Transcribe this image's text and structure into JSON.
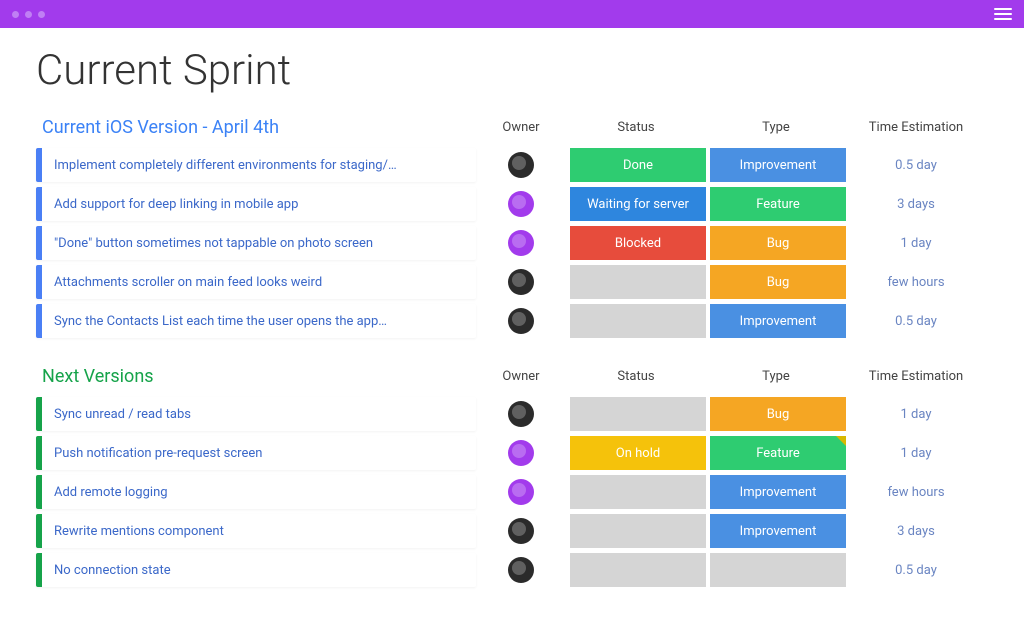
{
  "page_title": "Current Sprint",
  "columns": {
    "owner": "Owner",
    "status": "Status",
    "type": "Type",
    "time": "Time Estimation"
  },
  "status_colors": {
    "Done": "chip-done",
    "Waiting for server": "chip-waiting",
    "Blocked": "chip-blocked",
    "On hold": "chip-onhold",
    "": "chip-none"
  },
  "type_colors": {
    "Improvement": "chip-improvement",
    "Feature": "chip-feature",
    "Bug": "chip-bug"
  },
  "groups": [
    {
      "title": "Current iOS Version - April 4th",
      "stripe": "blue",
      "title_color": "blue",
      "rows": [
        {
          "task": "Implement completely different environments for staging/…",
          "owner": "dark",
          "status": "Done",
          "type": "Improvement",
          "time": "0.5 day"
        },
        {
          "task": "Add support for deep linking in mobile app",
          "owner": "purple",
          "status": "Waiting for server",
          "type": "Feature",
          "time": "3 days"
        },
        {
          "task": "\"Done\" button sometimes not tappable on photo screen",
          "owner": "purple",
          "status": "Blocked",
          "type": "Bug",
          "time": "1 day"
        },
        {
          "task": "Attachments scroller on main feed looks weird",
          "owner": "dark",
          "status": "",
          "type": "Bug",
          "time": "few hours"
        },
        {
          "task": "Sync the Contacts List each time the user opens the app…",
          "owner": "dark",
          "status": "",
          "type": "Improvement",
          "time": "0.5 day"
        }
      ]
    },
    {
      "title": "Next Versions",
      "stripe": "green",
      "title_color": "green",
      "rows": [
        {
          "task": "Sync unread / read tabs",
          "owner": "dark",
          "status": "",
          "type": "Bug",
          "time": "1 day"
        },
        {
          "task": "Push notification pre-request screen",
          "owner": "purple",
          "status": "On hold",
          "type": "Feature",
          "time": "1 day",
          "corner": true
        },
        {
          "task": "Add remote logging",
          "owner": "purple",
          "status": "",
          "type": "Improvement",
          "time": "few hours"
        },
        {
          "task": "Rewrite mentions component",
          "owner": "dark",
          "status": "",
          "type": "Improvement",
          "time": "3 days"
        },
        {
          "task": "No connection state",
          "owner": "dark",
          "status": "",
          "type": "",
          "time": "0.5 day"
        }
      ]
    }
  ]
}
